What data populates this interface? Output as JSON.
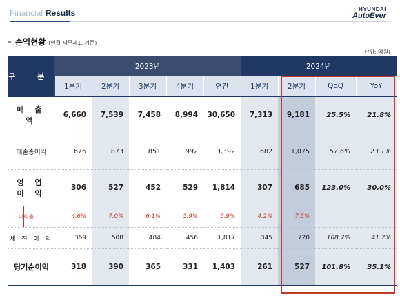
{
  "header": {
    "title_light": "Financial",
    "title_bold": "Results",
    "logo_top": "HYUNDAI",
    "logo_main": "AutoEver"
  },
  "section": {
    "title": "손익현황",
    "subtitle": "(연결 재무제표 기준)",
    "unit": "(단위: 억원)"
  },
  "table": {
    "corner_label": "구 분",
    "year_2023": "2023년",
    "year_2024": "2024년",
    "columns": [
      "1분기",
      "2분기",
      "3분기",
      "4분기",
      "연간",
      "1분기",
      "2분기",
      "QoQ",
      "YoY"
    ],
    "rows": [
      {
        "label": "매 출 액",
        "values": [
          "6,660",
          "7,539",
          "7,458",
          "8,994",
          "30,650",
          "7,313",
          "9,181",
          "25.5%",
          "21.8%"
        ]
      },
      {
        "label": "매출총이익",
        "values": [
          "676",
          "873",
          "851",
          "992",
          "3,392",
          "682",
          "1,075",
          "57.6%",
          "23.1%"
        ]
      },
      {
        "label": "영 업 이 익",
        "values": [
          "306",
          "527",
          "452",
          "529",
          "1,814",
          "307",
          "685",
          "123.0%",
          "30.0%"
        ]
      },
      {
        "label": "이익율",
        "values": [
          "4.6%",
          "7.0%",
          "6.1%",
          "5.9%",
          "5.9%",
          "4.2%",
          "7.5%",
          "",
          ""
        ]
      },
      {
        "label": "세 전 이 익",
        "values": [
          "369",
          "508",
          "484",
          "456",
          "1,817",
          "345",
          "720",
          "108.7%",
          "41.7%"
        ]
      },
      {
        "label": "당기순이익",
        "values": [
          "318",
          "390",
          "365",
          "331",
          "1,403",
          "261",
          "527",
          "101.8%",
          "35.1%"
        ]
      }
    ]
  },
  "colors": {
    "header_navy": "#1f3864",
    "highlight_red": "#c0392b",
    "margin_red": "#c0392b"
  }
}
